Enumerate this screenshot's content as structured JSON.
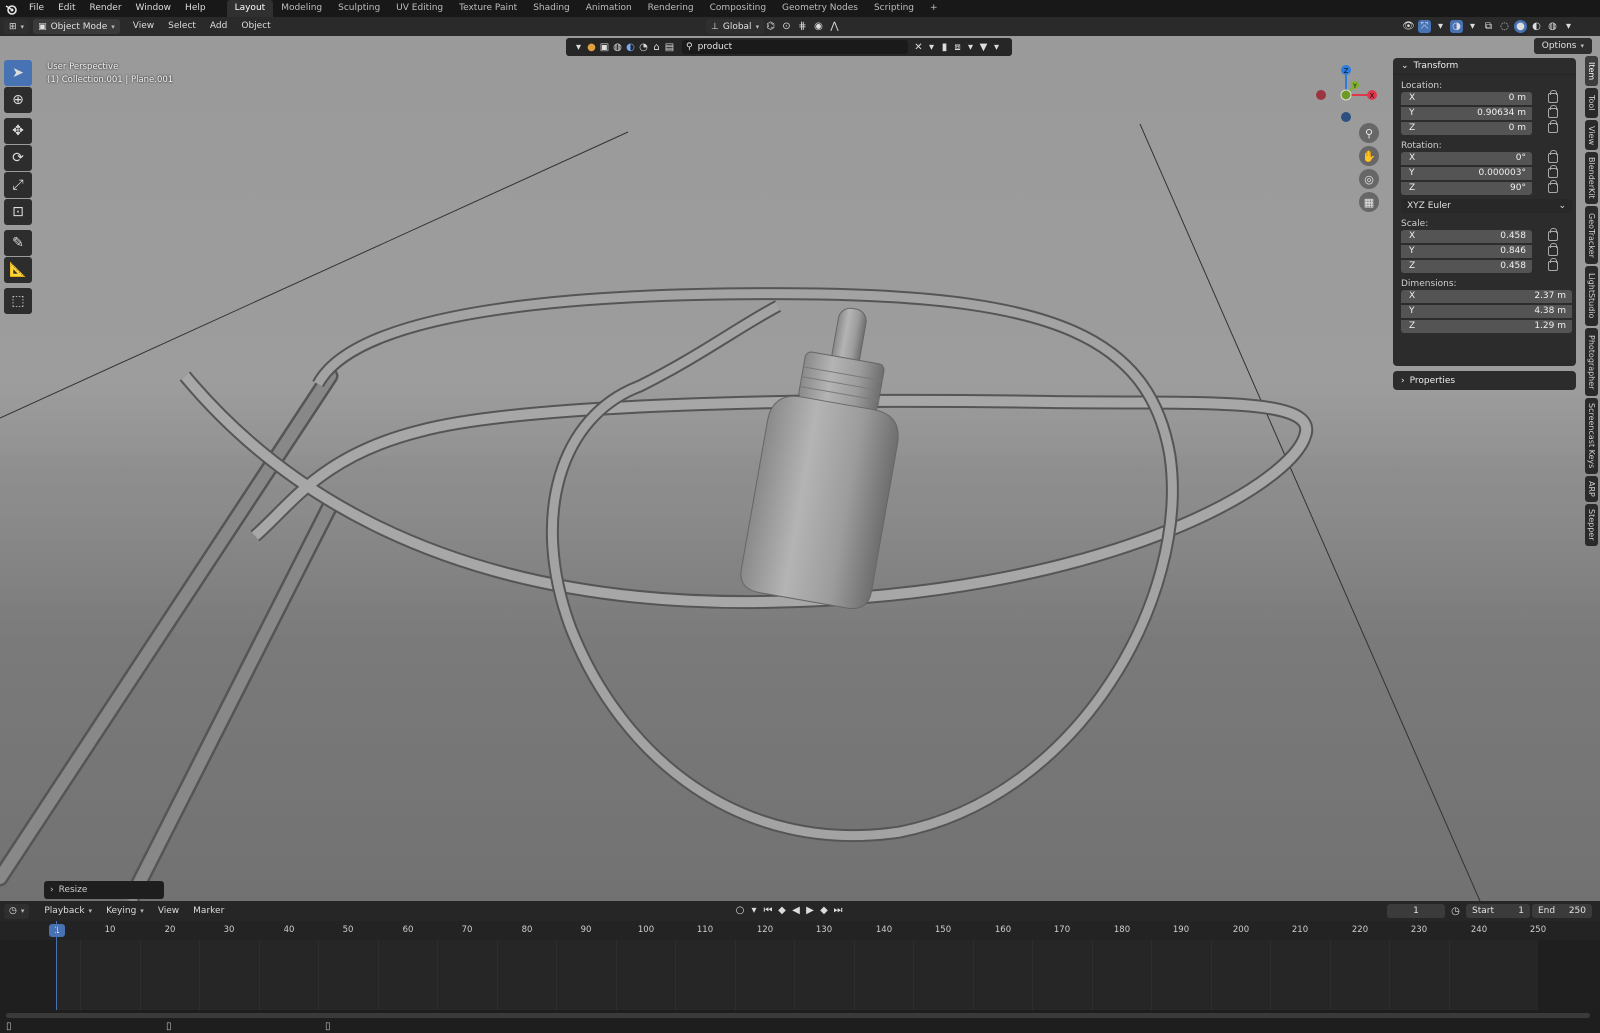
{
  "topbar": {
    "menus": [
      "File",
      "Edit",
      "Render",
      "Window",
      "Help"
    ],
    "workspaces": [
      "Layout",
      "Modeling",
      "Sculpting",
      "UV Editing",
      "Texture Paint",
      "Shading",
      "Animation",
      "Rendering",
      "Compositing",
      "Geometry Nodes",
      "Scripting"
    ],
    "active_workspace": "Layout",
    "add_tab_icon": "plus-icon"
  },
  "header": {
    "mode": "Object Mode",
    "menus": [
      "View",
      "Select",
      "Add",
      "Object"
    ],
    "orientation": "Global"
  },
  "viewport": {
    "perspective_label": "User Perspective",
    "collection_label": "(1) Collection.001 | Plane.001",
    "filter_search_value": "product",
    "options_label": "Options",
    "resize_panel_label": "Resize",
    "background_color": "#9a9a9a"
  },
  "gizmo": {
    "axes": {
      "x": "X",
      "y": "Y",
      "z": "Z"
    },
    "colors": {
      "x": "#e0374d",
      "y": "#7fb22c",
      "z": "#2c7be0"
    }
  },
  "npanel": {
    "transform_title": "Transform",
    "location_label": "Location:",
    "location": {
      "x": "0 m",
      "y": "0.90634 m",
      "z": "0 m"
    },
    "rotation_label": "Rotation:",
    "rotation": {
      "x": "0°",
      "y": "0.000003°",
      "z": "90°"
    },
    "rotation_mode": "XYZ Euler",
    "scale_label": "Scale:",
    "scale": {
      "x": "0.458",
      "y": "0.846",
      "z": "0.458"
    },
    "dimensions_label": "Dimensions:",
    "dimensions": {
      "x": "2.37 m",
      "y": "4.38 m",
      "z": "1.29 m"
    },
    "properties_title": "Properties",
    "axis_labels": [
      "X",
      "Y",
      "Z"
    ]
  },
  "side_tabs": [
    "Item",
    "Tool",
    "View",
    "BlenderKit",
    "GeoTracker",
    "LightStudio",
    "Photographer",
    "Screencast Keys",
    "ARP",
    "Stepper"
  ],
  "active_side_tab": "Item",
  "timeline": {
    "menus": [
      "Playback",
      "Keying",
      "View",
      "Marker"
    ],
    "current_frame": "1",
    "start_label": "Start",
    "start_value": "1",
    "end_label": "End",
    "end_value": "250",
    "ruler_ticks": [
      "10",
      "20",
      "30",
      "40",
      "50",
      "60",
      "70",
      "80",
      "90",
      "100",
      "110",
      "120",
      "130",
      "140",
      "150",
      "160",
      "170",
      "180",
      "190",
      "200",
      "210",
      "220",
      "230",
      "240",
      "250"
    ],
    "playhead_label": "1",
    "accent_color": "#4772b3"
  }
}
